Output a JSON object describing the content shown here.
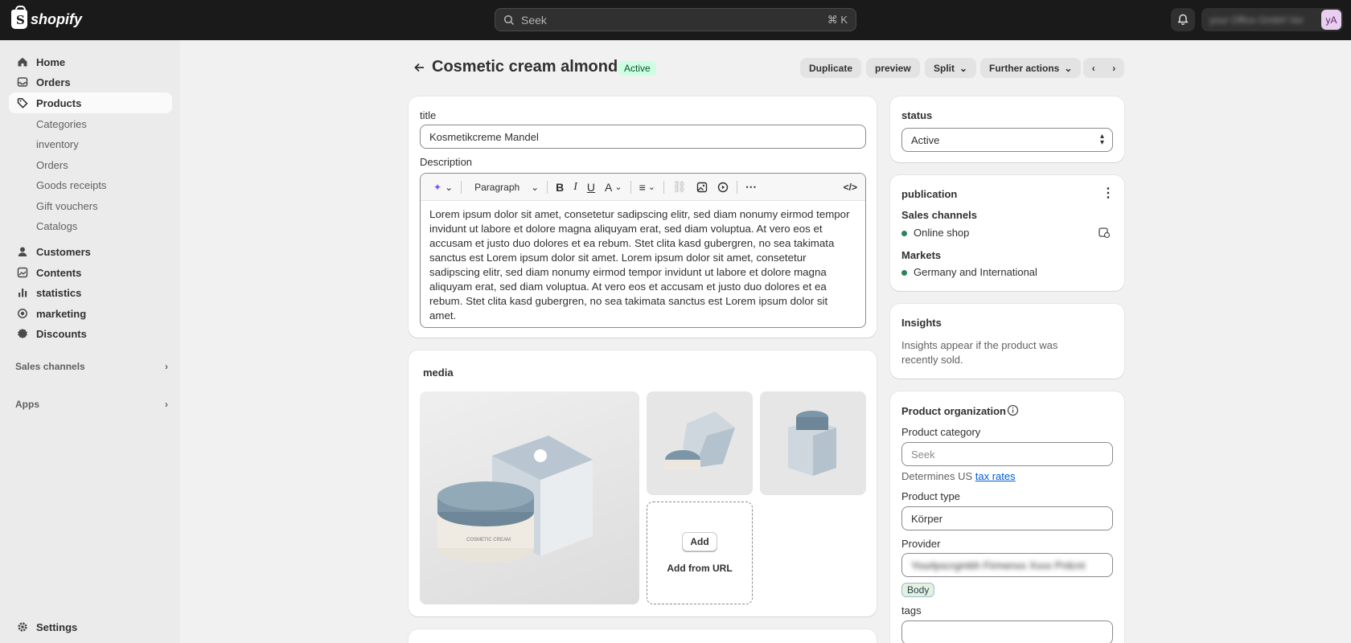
{
  "topbar": {
    "logo_text": "shopify",
    "search_placeholder": "Seek",
    "search_shortcut": "⌘ K",
    "account_name": "your Office GmbH Ver",
    "avatar_initials": "yA"
  },
  "sidebar": {
    "items": [
      {
        "label": "Home",
        "icon": "home-icon"
      },
      {
        "label": "Orders",
        "icon": "inbox-icon"
      },
      {
        "label": "Products",
        "icon": "tag-icon"
      }
    ],
    "product_sub": [
      "Categories",
      "inventory",
      "Orders",
      "Goods receipts",
      "Gift vouchers",
      "Catalogs"
    ],
    "items2": [
      {
        "label": "Customers",
        "icon": "person-icon"
      },
      {
        "label": "Contents",
        "icon": "contents-icon"
      },
      {
        "label": "statistics",
        "icon": "bar-chart-icon"
      },
      {
        "label": "marketing",
        "icon": "target-icon"
      },
      {
        "label": "Discounts",
        "icon": "discount-icon"
      }
    ],
    "sales_channels": "Sales channels",
    "apps": "Apps",
    "settings": "Settings"
  },
  "header": {
    "title": "Cosmetic cream almond",
    "status_badge": "Active",
    "duplicate": "Duplicate",
    "preview": "preview",
    "split": "Split",
    "further_actions": "Further actions"
  },
  "product": {
    "title_label": "title",
    "title_value": "Kosmetikcreme Mandel",
    "description_label": "Description",
    "paragraph_select": "Paragraph",
    "description": "Lorem ipsum dolor sit amet, consetetur sadipscing elitr, sed diam nonumy eirmod tempor invidunt ut labore et dolore magna aliquyam erat, sed diam voluptua. At vero eos et accusam et justo duo dolores et ea rebum. Stet clita kasd gubergren, no sea takimata sanctus est Lorem ipsum dolor sit amet. Lorem ipsum dolor sit amet, consetetur sadipscing elitr, sed diam nonumy eirmod tempor invidunt ut labore et dolore magna aliquyam erat, sed diam voluptua. At vero eos et accusam et justo duo dolores et ea rebum. Stet clita kasd gubergren, no sea takimata sanctus est Lorem ipsum dolor sit amet."
  },
  "media": {
    "title": "media",
    "add": "Add",
    "add_from_url": "Add from URL",
    "jar_label": "COSMETIC CREAM"
  },
  "status": {
    "label": "status",
    "value": "Active"
  },
  "publication": {
    "title": "publication",
    "sales_channels_label": "Sales channels",
    "online_shop": "Online shop",
    "markets_label": "Markets",
    "markets_value": "Germany and International"
  },
  "insights": {
    "title": "Insights",
    "text": "Insights appear if the product was recently sold."
  },
  "organization": {
    "title": "Product organization",
    "category_label": "Product category",
    "category_placeholder": "Seek",
    "determines": "Determines US",
    "tax_rates": "tax rates",
    "type_label": "Product type",
    "type_value": "Körper",
    "provider_label": "Provider",
    "provider_value": "Yourlpscrgmbh Firmenxx Xxxx Prdcnt",
    "body_tag": "Body",
    "tags_label": "tags"
  }
}
